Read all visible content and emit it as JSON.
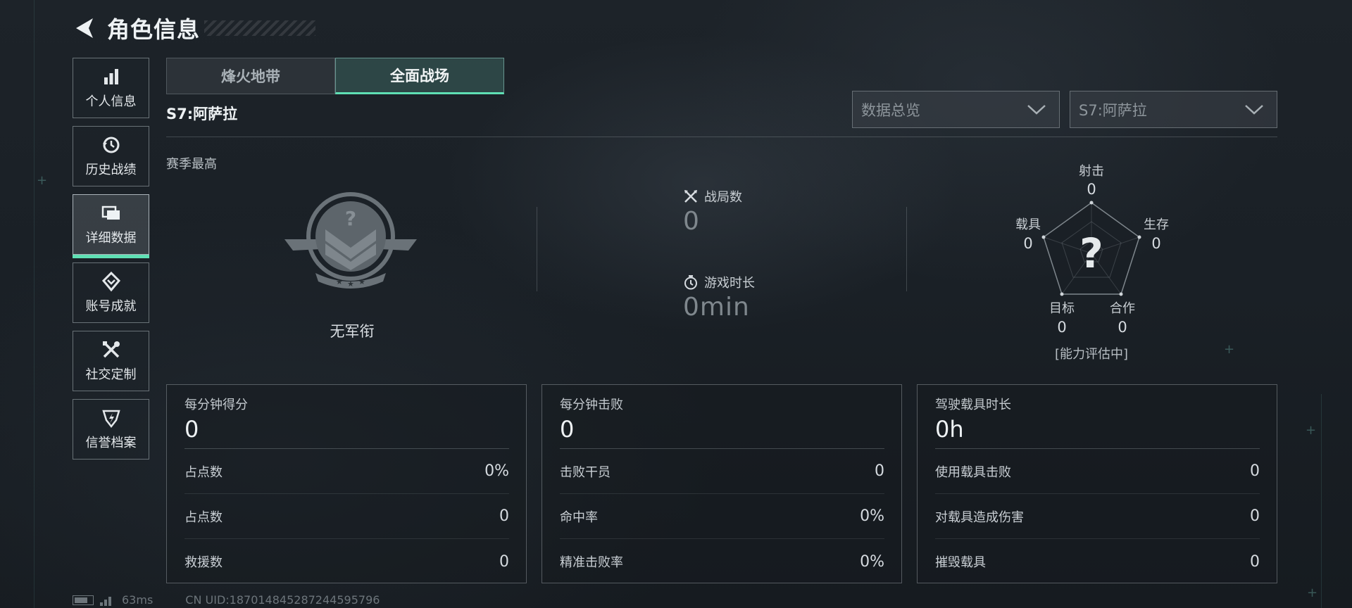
{
  "header": {
    "title": "角色信息"
  },
  "sidebar": {
    "items": [
      {
        "label": "个人信息",
        "icon": "bar-chart-icon",
        "active": false
      },
      {
        "label": "历史战绩",
        "icon": "history-icon",
        "active": false
      },
      {
        "label": "详细数据",
        "icon": "folder-icon",
        "active": true
      },
      {
        "label": "账号成就",
        "icon": "achievement-icon",
        "active": false
      },
      {
        "label": "社交定制",
        "icon": "tools-icon",
        "active": false
      },
      {
        "label": "信誉档案",
        "icon": "credit-shield-icon",
        "active": false
      }
    ]
  },
  "tabs": [
    {
      "label": "烽火地带",
      "active": false
    },
    {
      "label": "全面战场",
      "active": true
    }
  ],
  "season": {
    "label": "S7:阿萨拉"
  },
  "filters": {
    "view": "数据总览",
    "season": "S7:阿萨拉"
  },
  "overview": {
    "season_best_label": "赛季最高",
    "rank_name": "无军衔",
    "matches_label": "战局数",
    "matches_value": "0",
    "playtime_label": "游戏时长",
    "playtime_value": "0min"
  },
  "radar": {
    "center_symbol": "?",
    "status": "[能力评估中]",
    "axes": [
      {
        "label": "射击",
        "value": "0"
      },
      {
        "label": "生存",
        "value": "0"
      },
      {
        "label": "合作",
        "value": "0"
      },
      {
        "label": "目标",
        "value": "0"
      },
      {
        "label": "载具",
        "value": "0"
      }
    ]
  },
  "panels": [
    {
      "title": "每分钟得分",
      "value": "0",
      "rows": [
        {
          "label": "占点数",
          "value": "0%"
        },
        {
          "label": "占点数",
          "value": "0"
        },
        {
          "label": "救援数",
          "value": "0"
        }
      ]
    },
    {
      "title": "每分钟击败",
      "value": "0",
      "rows": [
        {
          "label": "击败干员",
          "value": "0"
        },
        {
          "label": "命中率",
          "value": "0%"
        },
        {
          "label": "精准击败率",
          "value": "0%"
        }
      ]
    },
    {
      "title": "驾驶载具时长",
      "value": "0h",
      "rows": [
        {
          "label": "使用载具击败",
          "value": "0"
        },
        {
          "label": "对载具造成伤害",
          "value": "0"
        },
        {
          "label": "摧毁载具",
          "value": "0"
        }
      ]
    }
  ],
  "footer": {
    "ping": "63ms",
    "uid": "CN UID:1870148452872445957​96"
  },
  "colors": {
    "accent": "#5fe0b4"
  }
}
